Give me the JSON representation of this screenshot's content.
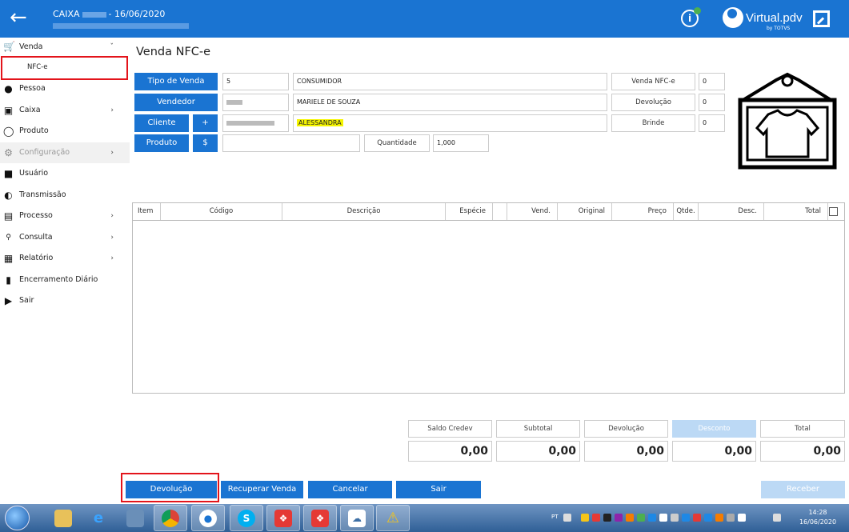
{
  "titlebar": {
    "caixa": "CAIXA",
    "date": "- 16/06/2020",
    "logo_text": "Virtual.pdv",
    "logo_sub": "by TOTVS"
  },
  "sidebar": {
    "items": [
      {
        "label": "Venda",
        "icon": "cart-icon"
      },
      {
        "label": "NFC-e",
        "icon": ""
      },
      {
        "label": "Pessoa",
        "icon": "person-icon"
      },
      {
        "label": "Caixa",
        "icon": "cash-register-icon"
      },
      {
        "label": "Produto",
        "icon": "tag-icon"
      },
      {
        "label": "Configuração",
        "icon": "gears-icon"
      },
      {
        "label": "Usuário",
        "icon": "users-icon"
      },
      {
        "label": "Transmissão",
        "icon": "satellite-icon"
      },
      {
        "label": "Processo",
        "icon": "monitor-icon"
      },
      {
        "label": "Consulta",
        "icon": "search-icon"
      },
      {
        "label": "Relatório",
        "icon": "report-icon"
      },
      {
        "label": "Encerramento Diário",
        "icon": "book-icon"
      },
      {
        "label": "Sair",
        "icon": "exit-icon"
      }
    ]
  },
  "page": {
    "title": "Venda NFC-e"
  },
  "form": {
    "tipo_venda_label": "Tipo de Venda",
    "tipo_venda_code": "5",
    "tipo_venda_desc": "CONSUMIDOR",
    "vendedor_label": "Vendedor",
    "vendedor_name": "MARIELE DE SOUZA",
    "cliente_label": "Cliente",
    "cliente_add": "+",
    "cliente_name": "ALESSANDRA",
    "produto_label": "Produto",
    "produto_price_btn": "$",
    "produto_value": "",
    "quantidade_label": "Quantidade",
    "quantidade_value": "1,000",
    "venda_nfce_label": "Venda NFC-e",
    "venda_nfce_value": "0",
    "devolucao_label": "Devolução",
    "devolucao_value": "0",
    "brinde_label": "Brinde",
    "brinde_value": "0"
  },
  "table": {
    "columns": [
      "Item",
      "Código",
      "Descrição",
      "Espécie",
      "",
      "Vend.",
      "Original",
      "Preço",
      "Qtde.",
      "Desc.",
      "Total"
    ],
    "rows": []
  },
  "totals": {
    "saldo_credev_label": "Saldo Credev",
    "saldo_credev_value": "",
    "subtotal_label": "Subtotal",
    "subtotal_value": "0,00",
    "devolucao_label": "Devolução",
    "devolucao_value": "0,00",
    "desconto_label": "Desconto",
    "desconto_value": "0,00",
    "total_label": "Total",
    "total_value": "0,00",
    "left_value": "0,00"
  },
  "actions": {
    "devolucao": "Devolução",
    "recuperar": "Recuperar Venda",
    "cancelar": "Cancelar",
    "sair": "Sair",
    "receber": "Receber"
  },
  "taskbar": {
    "lang": "PT",
    "time": "14:28",
    "date": "16/06/2020"
  },
  "colors": {
    "primary": "#1a74d2",
    "disabled": "#bcd9f5",
    "highlight": "#f5f500",
    "red_box": "#e3141b"
  }
}
